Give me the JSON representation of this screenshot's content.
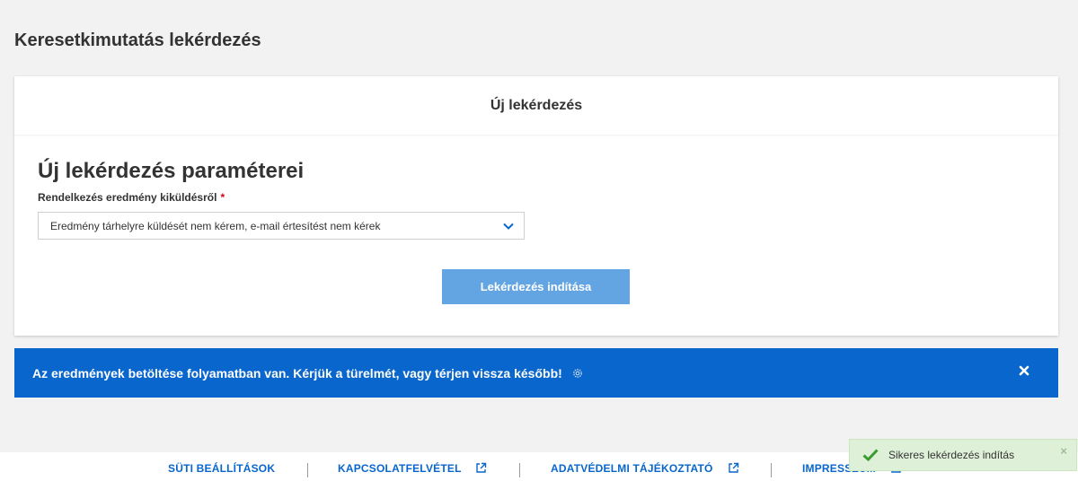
{
  "page": {
    "title": "Keresetkimutatás lekérdezés"
  },
  "card": {
    "header": "Új lekérdezés",
    "section_title": "Új lekérdezés paraméterei",
    "field_label": "Rendelkezés eredmény kiküldésről",
    "required_mark": "*",
    "select_value": "Eredmény tárhelyre küldését nem kérem, e-mail értesítést nem kérek",
    "submit_label": "Lekérdezés indítása"
  },
  "banner": {
    "text": "Az eredmények betöltése folyamatban van. Kérjük a türelmét, vagy térjen vissza később!",
    "close_glyph": "✖"
  },
  "footer": {
    "cookies": "SÜTI BEÁLLÍTÁSOK",
    "contact": "KAPCSOLATFELVÉTEL",
    "privacy": "ADATVÉDELMI TÁJÉKOZTATÓ",
    "imprint": "IMPRESSZUM"
  },
  "toast": {
    "text": "Sikeres lekérdezés indítás",
    "close_glyph": "×"
  },
  "colors": {
    "accent": "#0866cc",
    "button": "#63a4e3",
    "success_bg": "#dff0d8",
    "success_icon": "#3a9b2e",
    "required": "#d0021b"
  },
  "icons": [
    "chevron-down-icon",
    "gear-icon",
    "close-icon",
    "external-link-icon",
    "check-icon"
  ]
}
